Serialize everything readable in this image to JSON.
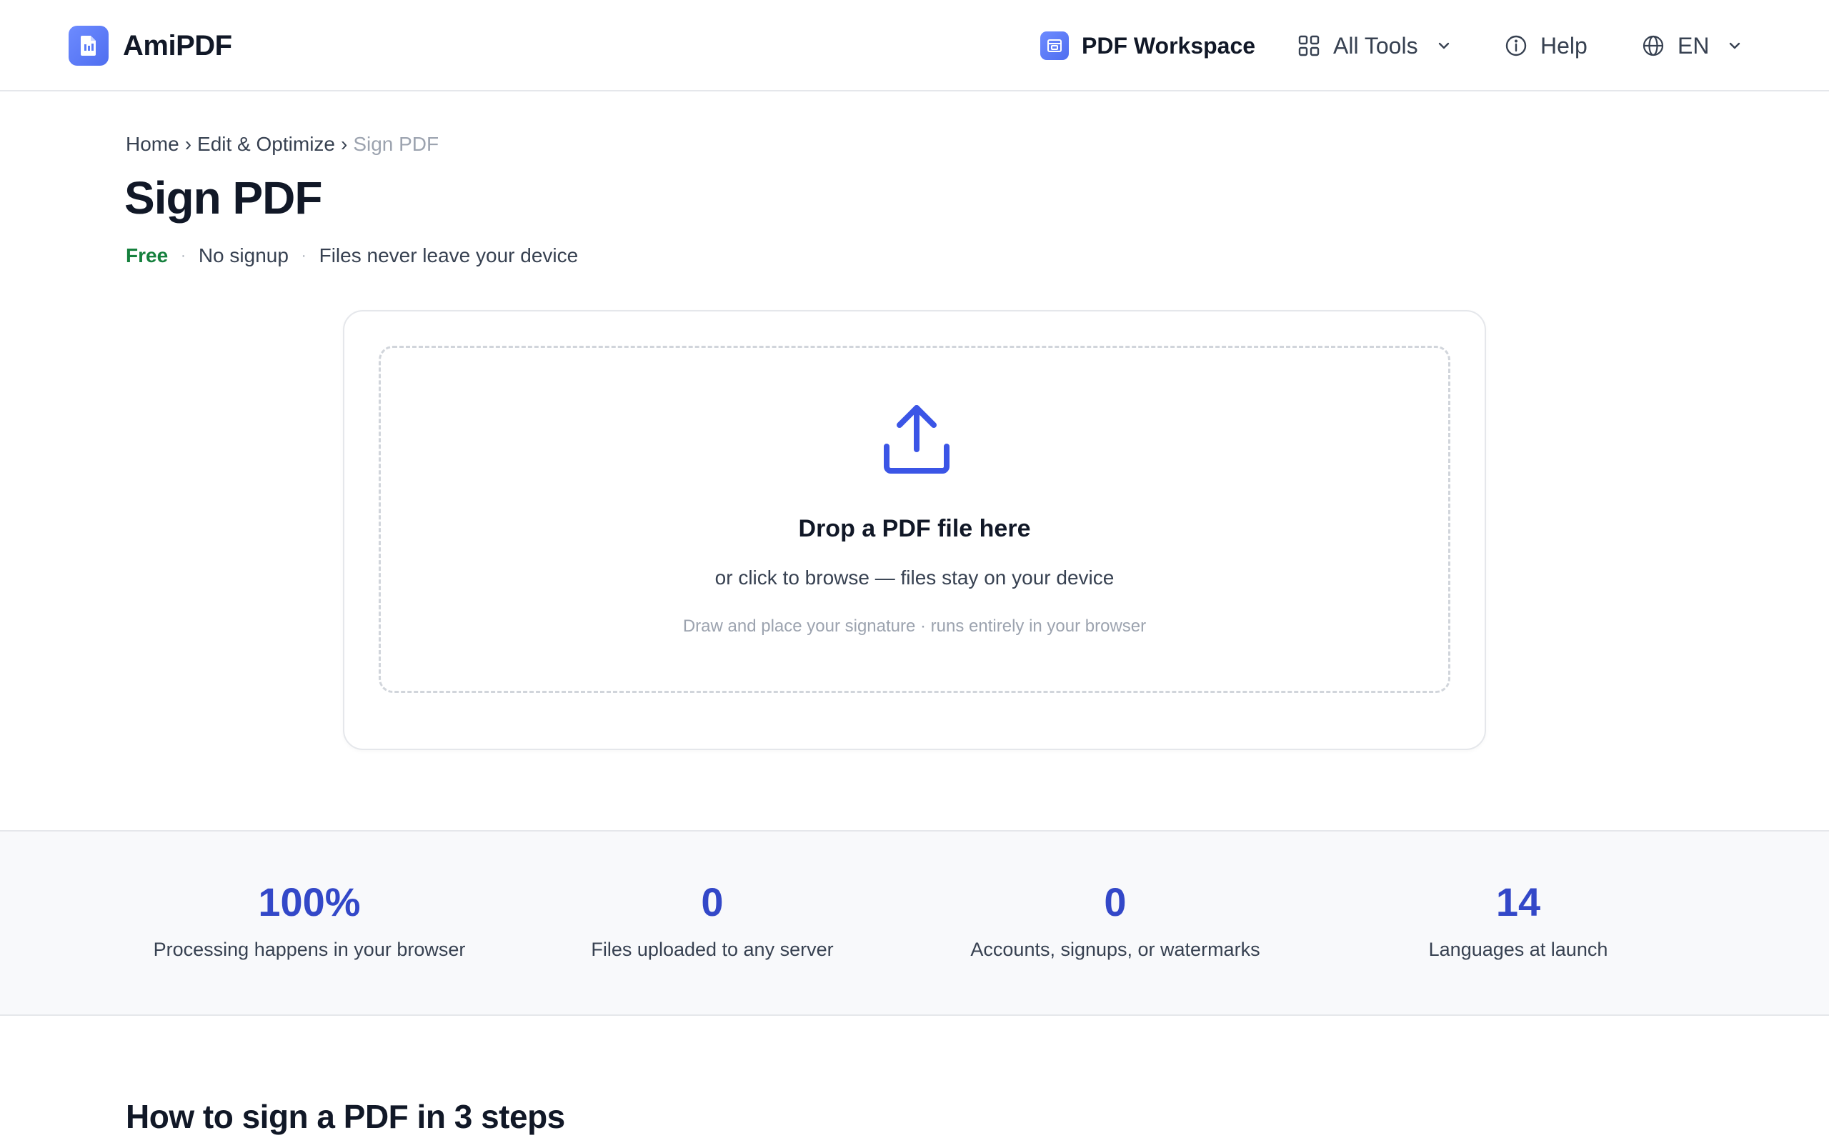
{
  "header": {
    "brand": "AmiPDF",
    "nav": {
      "workspace": "PDF Workspace",
      "all_tools": "All Tools",
      "help": "Help",
      "language": "EN"
    }
  },
  "breadcrumb": {
    "home": "Home",
    "sep": "›",
    "category": "Edit & Optimize",
    "current": "Sign PDF"
  },
  "page": {
    "title": "Sign PDF",
    "tags": {
      "free": "Free",
      "dot": "·",
      "no_signup": "No signup",
      "privacy": "Files never leave your device"
    }
  },
  "dropzone": {
    "title": "Drop a PDF file here",
    "subtitle": "or click to browse — files stay on your device",
    "hint": "Draw and place your signature · runs entirely in your browser"
  },
  "stats": [
    {
      "value": "100%",
      "label": "Processing happens in your browser"
    },
    {
      "value": "0",
      "label": "Files uploaded to any server"
    },
    {
      "value": "0",
      "label": "Accounts, signups, or watermarks"
    },
    {
      "value": "14",
      "label": "Languages at launch"
    }
  ],
  "steps": {
    "title": "How to sign a PDF in 3 steps"
  },
  "icons": {
    "logo": "pdf-file-icon",
    "workspace": "workspace-icon",
    "all_tools": "grid-icon",
    "help": "info-icon",
    "language": "globe-icon",
    "upload": "upload-icon"
  },
  "colors": {
    "brand": "#5b7cf7",
    "stat_value": "#3348c8",
    "free": "#15803d",
    "upload_icon": "#3b55e6"
  }
}
